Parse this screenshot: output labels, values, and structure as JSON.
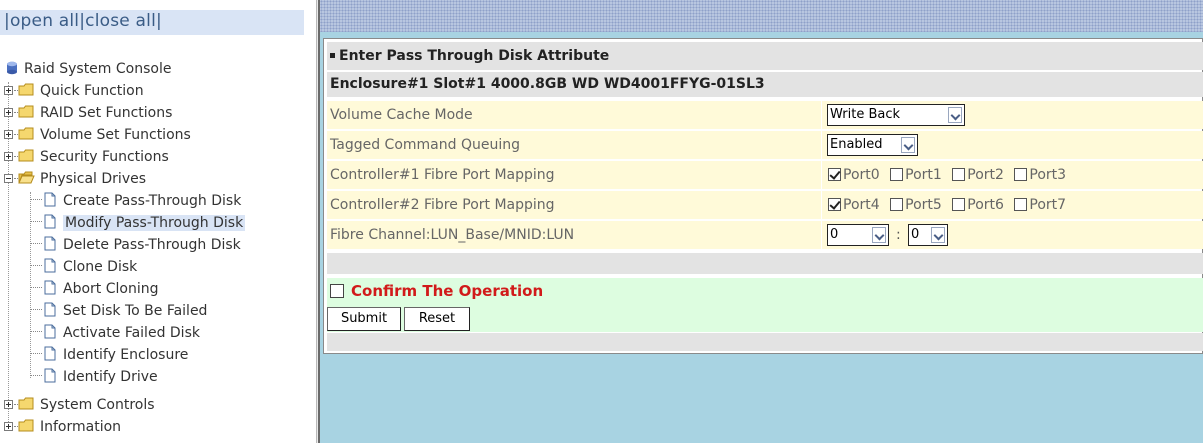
{
  "nav": {
    "open_all": "open all",
    "close_all": "close all",
    "sep": "|",
    "root_label": "Raid System Console",
    "folders_top": [
      "Quick Function",
      "RAID Set Functions",
      "Volume Set Functions",
      "Security Functions"
    ],
    "physical_drives": "Physical Drives",
    "children": [
      "Create Pass-Through Disk",
      "Modify Pass-Through Disk",
      "Delete Pass-Through Disk",
      "Clone Disk",
      "Abort Cloning",
      "Set Disk To Be Failed",
      "Activate Failed Disk",
      "Identify Enclosure",
      "Identify Drive"
    ],
    "folders_bottom": [
      "System Controls",
      "Information"
    ]
  },
  "form": {
    "title": "Enter Pass Through Disk Attribute",
    "disk": "Enclosure#1 Slot#1 4000.8GB WD WD4001FFYG-01SL3",
    "rows": {
      "cache_label": "Volume Cache Mode",
      "cache_value": "Write Back",
      "tcq_label": "Tagged Command Queuing",
      "tcq_value": "Enabled",
      "c1_label": "Controller#1 Fibre Port Mapping",
      "c2_label": "Controller#2 Fibre Port Mapping",
      "lun_label": "Fibre Channel:LUN_Base/MNID:LUN",
      "lun_base": "0",
      "lun_sep": ":",
      "lun_value": "0"
    },
    "ports_c1": [
      {
        "label": "Port0",
        "checked": true
      },
      {
        "label": "Port1",
        "checked": false
      },
      {
        "label": "Port2",
        "checked": false
      },
      {
        "label": "Port3",
        "checked": false
      }
    ],
    "ports_c2": [
      {
        "label": "Port4",
        "checked": true
      },
      {
        "label": "Port5",
        "checked": false
      },
      {
        "label": "Port6",
        "checked": false
      },
      {
        "label": "Port7",
        "checked": false
      }
    ],
    "confirm": "Confirm The Operation",
    "submit": "Submit",
    "reset": "Reset"
  },
  "colors": {
    "confirm_text": "#d11a1a",
    "label_row_bg": "#fffad9",
    "action_row_bg": "#ddfde0",
    "header_bg": "#e3e3e3",
    "frame_bg": "#a8d3e2"
  }
}
